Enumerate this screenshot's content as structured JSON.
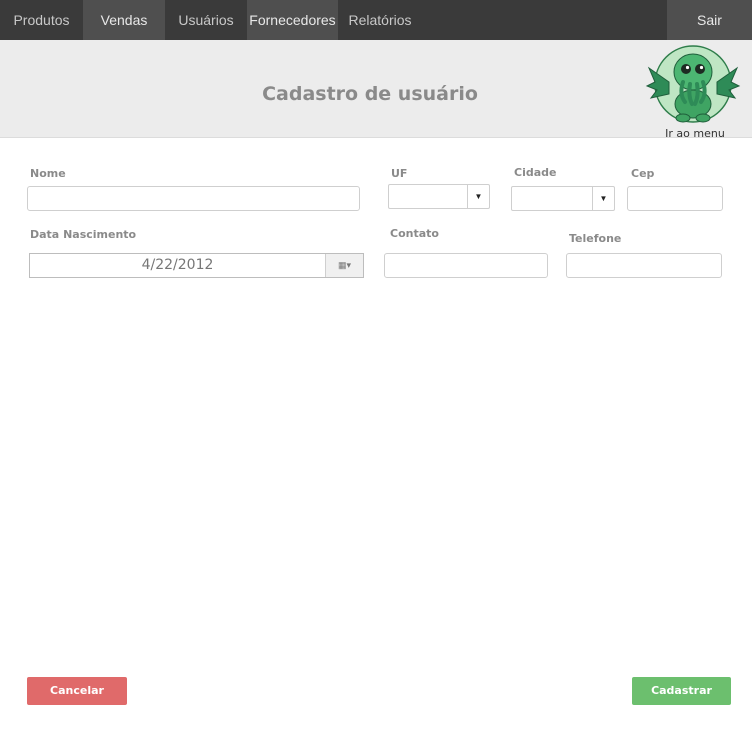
{
  "nav": {
    "items": [
      {
        "label": "Produtos"
      },
      {
        "label": "Vendas"
      },
      {
        "label": "Usuários"
      },
      {
        "label": "Fornecedores"
      },
      {
        "label": "Relatórios"
      }
    ],
    "logout_label": "Sair"
  },
  "header": {
    "title": "Cadastro de usuário",
    "menu_link_label": "Ir ao menu",
    "logo_icon": "cthulhu-mascot-icon"
  },
  "form": {
    "nome": {
      "label": "Nome",
      "value": ""
    },
    "uf": {
      "label": "UF",
      "value": ""
    },
    "cidade": {
      "label": "Cidade",
      "value": ""
    },
    "cep": {
      "label": "Cep",
      "value": ""
    },
    "data_nascimento": {
      "label": "Data Nascimento",
      "value": "4/22/2012"
    },
    "contato": {
      "label": "Contato",
      "value": ""
    },
    "telefone": {
      "label": "Telefone",
      "value": ""
    }
  },
  "actions": {
    "cancel_label": "Cancelar",
    "submit_label": "Cadastrar"
  },
  "colors": {
    "nav_bg": "#3a3a3a",
    "cancel": "#e06a6a",
    "submit": "#6cbf6e",
    "mascot_green": "#3fa463"
  }
}
